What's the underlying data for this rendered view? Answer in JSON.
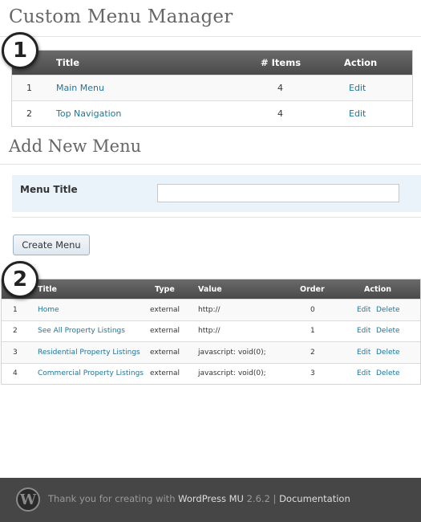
{
  "page": {
    "title": "Custom Menu Manager",
    "add_title": "Add New Menu",
    "step1": "1",
    "step2": "2"
  },
  "menus_table": {
    "headers": {
      "title": "Title",
      "items": "# Items",
      "action": "Action"
    },
    "rows": [
      {
        "num": "1",
        "title": "Main Menu",
        "items": "4",
        "action": "Edit"
      },
      {
        "num": "2",
        "title": "Top Navigation",
        "items": "4",
        "action": "Edit"
      }
    ]
  },
  "add_form": {
    "label": "Menu Title",
    "value": "",
    "button": "Create Menu"
  },
  "items_table": {
    "headers": {
      "title": "Title",
      "type": "Type",
      "value": "Value",
      "order": "Order",
      "action": "Action"
    },
    "rows": [
      {
        "num": "1",
        "title": "Home",
        "type": "external",
        "value": "http://",
        "order": "0",
        "edit": "Edit",
        "delete": "Delete"
      },
      {
        "num": "2",
        "title": "See All Property Listings",
        "type": "external",
        "value": "http://",
        "order": "1",
        "edit": "Edit",
        "delete": "Delete"
      },
      {
        "num": "3",
        "title": "Residential Property Listings",
        "type": "external",
        "value": "javascript: void(0);",
        "order": "2",
        "edit": "Edit",
        "delete": "Delete"
      },
      {
        "num": "4",
        "title": "Commercial Property Listings",
        "type": "external",
        "value": "javascript: void(0);",
        "order": "3",
        "edit": "Edit",
        "delete": "Delete"
      }
    ]
  },
  "footer": {
    "logo_icon": "wordpress-logo-icon",
    "logo_letter": "W",
    "text_before": "Thank you for creating with ",
    "wp_link": "WordPress MU",
    "version": " 2.6.2",
    "separator": " | ",
    "doc_link": "Documentation"
  },
  "colors": {
    "link": "#21759b",
    "header_bg": "#4a4a4a",
    "form_bg": "#eaf2fa",
    "footer_bg": "#464646"
  }
}
